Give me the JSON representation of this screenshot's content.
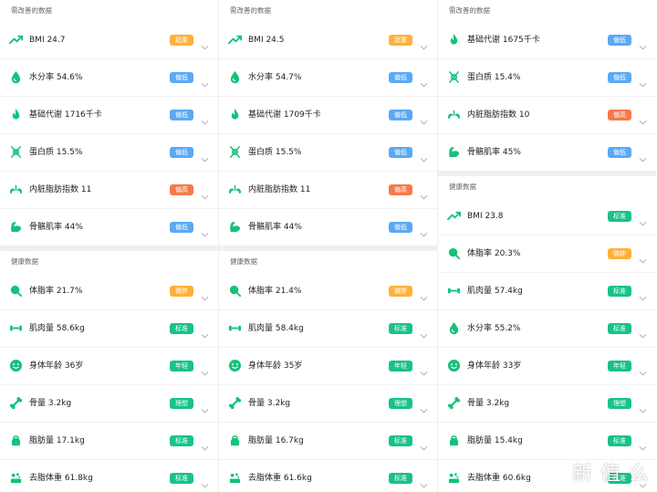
{
  "colors": {
    "green_icon": "#14c27a",
    "badge_orange": "#ffb038",
    "badge_blue": "#5aa9f5",
    "badge_red": "#f47a4a",
    "badge_green": "#19c286"
  },
  "columns": [
    {
      "improve_title": "需改善的数据",
      "improve_items": [
        {
          "label": "BMI 24.7",
          "badge": "超重",
          "color": "orange",
          "icon": "trend-up-icon"
        },
        {
          "label": "水分率 54.6%",
          "badge": "偏低",
          "color": "blue",
          "icon": "water-drop-icon"
        },
        {
          "label": "基础代谢 1716千卡",
          "badge": "偏低",
          "color": "blue",
          "icon": "flame-icon"
        },
        {
          "label": "蛋白质 15.5%",
          "badge": "偏低",
          "color": "blue",
          "icon": "protein-icon"
        },
        {
          "label": "内脏脂肪指数 11",
          "badge": "偏高",
          "color": "red",
          "icon": "visceral-fat-icon"
        },
        {
          "label": "骨骼肌率 44%",
          "badge": "偏低",
          "color": "blue",
          "icon": "muscle-arm-icon"
        }
      ],
      "health_title": "健康数据",
      "health_items": [
        {
          "label": "体脂率 21.7%",
          "badge": "微胖",
          "color": "orange",
          "icon": "body-fat-icon"
        },
        {
          "label": "肌肉量 58.6kg",
          "badge": "标准",
          "color": "green",
          "icon": "dumbbell-icon"
        },
        {
          "label": "身体年龄 36岁",
          "badge": "年轻",
          "color": "green",
          "icon": "smiley-icon"
        },
        {
          "label": "骨量 3.2kg",
          "badge": "理想",
          "color": "green",
          "icon": "bone-icon"
        },
        {
          "label": "脂肪量 17.1kg",
          "badge": "标准",
          "color": "green",
          "icon": "kettlebell-icon"
        },
        {
          "label": "去脂体重 61.8kg",
          "badge": "标准",
          "color": "green",
          "icon": "lean-mass-icon"
        }
      ]
    },
    {
      "improve_title": "需改善的数据",
      "improve_items": [
        {
          "label": "BMI 24.5",
          "badge": "超重",
          "color": "orange",
          "icon": "trend-up-icon"
        },
        {
          "label": "水分率 54.7%",
          "badge": "偏低",
          "color": "blue",
          "icon": "water-drop-icon"
        },
        {
          "label": "基础代谢 1709千卡",
          "badge": "偏低",
          "color": "blue",
          "icon": "flame-icon"
        },
        {
          "label": "蛋白质 15.5%",
          "badge": "偏低",
          "color": "blue",
          "icon": "protein-icon"
        },
        {
          "label": "内脏脂肪指数 11",
          "badge": "偏高",
          "color": "red",
          "icon": "visceral-fat-icon"
        },
        {
          "label": "骨骼肌率 44%",
          "badge": "偏低",
          "color": "blue",
          "icon": "muscle-arm-icon"
        }
      ],
      "health_title": "健康数据",
      "health_items": [
        {
          "label": "体脂率 21.4%",
          "badge": "微胖",
          "color": "orange",
          "icon": "body-fat-icon"
        },
        {
          "label": "肌肉量 58.4kg",
          "badge": "标准",
          "color": "green",
          "icon": "dumbbell-icon"
        },
        {
          "label": "身体年龄 35岁",
          "badge": "年轻",
          "color": "green",
          "icon": "smiley-icon"
        },
        {
          "label": "骨量 3.2kg",
          "badge": "理想",
          "color": "green",
          "icon": "bone-icon"
        },
        {
          "label": "脂肪量 16.7kg",
          "badge": "标准",
          "color": "green",
          "icon": "kettlebell-icon"
        },
        {
          "label": "去脂体重 61.6kg",
          "badge": "标准",
          "color": "green",
          "icon": "lean-mass-icon"
        }
      ]
    },
    {
      "improve_title": "需改善的数据",
      "improve_items": [
        {
          "label": "基础代谢 1675千卡",
          "badge": "偏低",
          "color": "blue",
          "icon": "flame-icon"
        },
        {
          "label": "蛋白质 15.4%",
          "badge": "偏低",
          "color": "blue",
          "icon": "protein-icon"
        },
        {
          "label": "内脏脂肪指数 10",
          "badge": "偏高",
          "color": "red",
          "icon": "visceral-fat-icon"
        },
        {
          "label": "骨骼肌率 45%",
          "badge": "偏低",
          "color": "blue",
          "icon": "muscle-arm-icon"
        }
      ],
      "health_title": "健康数据",
      "health_items": [
        {
          "label": "BMI 23.8",
          "badge": "标准",
          "color": "green",
          "icon": "trend-up-icon"
        },
        {
          "label": "体脂率 20.3%",
          "badge": "微胖",
          "color": "orange",
          "icon": "body-fat-icon"
        },
        {
          "label": "肌肉量 57.4kg",
          "badge": "标准",
          "color": "green",
          "icon": "dumbbell-icon"
        },
        {
          "label": "水分率 55.2%",
          "badge": "标准",
          "color": "green",
          "icon": "water-drop-icon"
        },
        {
          "label": "身体年龄 33岁",
          "badge": "年轻",
          "color": "green",
          "icon": "smiley-icon"
        },
        {
          "label": "骨量 3.2kg",
          "badge": "理想",
          "color": "green",
          "icon": "bone-icon"
        },
        {
          "label": "脂肪量 15.4kg",
          "badge": "标准",
          "color": "green",
          "icon": "kettlebell-icon"
        },
        {
          "label": "去脂体重 60.6kg",
          "badge": "标准",
          "color": "green",
          "icon": "lean-mass-icon"
        }
      ]
    }
  ],
  "watermark": "新 值 么"
}
